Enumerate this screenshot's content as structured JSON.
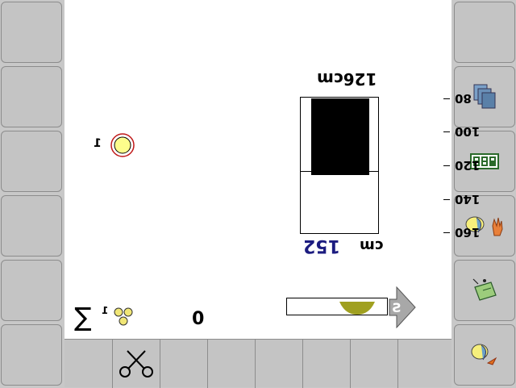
{
  "height_gauge": {
    "target_label": "126cm",
    "current_value": "152",
    "current_unit": "cm",
    "scale_labels": [
      "80",
      "100",
      "120",
      "140",
      "160"
    ],
    "scale_min": 80,
    "scale_max": 160,
    "fill_from": 80,
    "fill_to": 126
  },
  "status": {
    "row_number": "1",
    "sum_symbol": "∑",
    "sum_row_number": "1",
    "count_value": "0",
    "direction_label": "S"
  },
  "colors": {
    "background": "#ffffff",
    "softkey": "#c4c4c4",
    "indicator_fill": "#fdfd8c",
    "indicator_ring": "#c01818",
    "seeds": "#f0e676",
    "value_blue": "#1c1c80",
    "olive": "#a0a020"
  },
  "icons": {
    "right_softkeys": [
      "blank",
      "copy-pages-icon",
      "digital-counter-icon",
      "seed-and-hand-icon",
      "seed-drill-icon",
      "seed-calibration-icon"
    ],
    "bottom_keys": [
      "blank",
      "scissors-icon",
      "blank",
      "blank",
      "blank",
      "blank",
      "blank",
      "blank"
    ]
  }
}
